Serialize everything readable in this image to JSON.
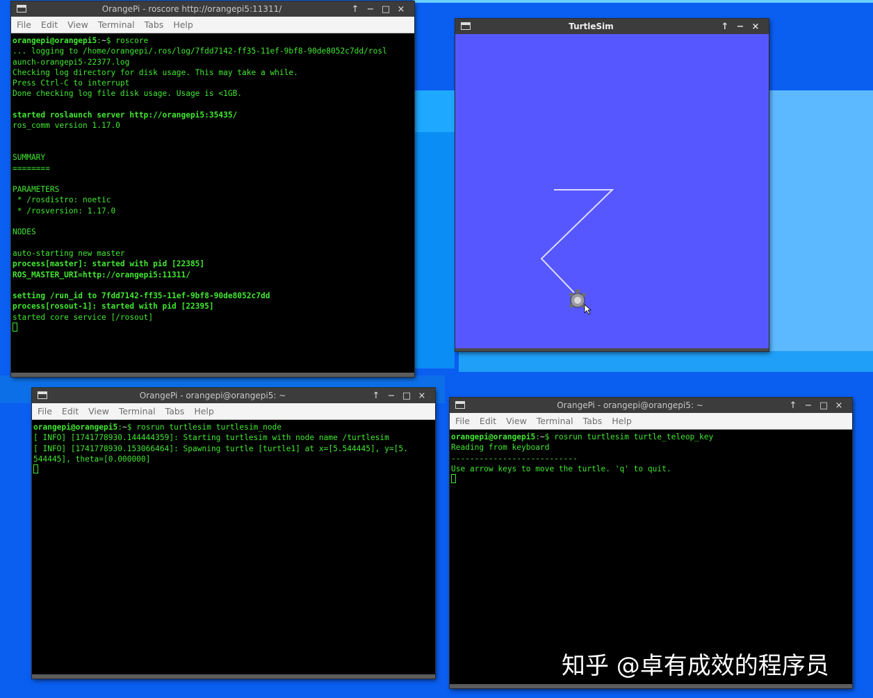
{
  "menu": [
    "File",
    "Edit",
    "View",
    "Terminal",
    "Tabs",
    "Help"
  ],
  "window_controls": [
    "↑",
    "−",
    "□",
    "×"
  ],
  "roscore_window": {
    "title": "OrangePi - roscore http://orangepi5:11311/",
    "lines": [
      [
        {
          "t": "orangepi@orangepi5",
          "c": "b"
        },
        {
          "t": ":",
          "c": ""
        },
        {
          "t": "~",
          "c": "w"
        },
        {
          "t": "$ roscore",
          "c": ""
        }
      ],
      [
        {
          "t": "... logging to /home/orangepi/.ros/log/7fdd7142-ff35-11ef-9bf8-90de8052c7dd/rosl",
          "c": ""
        }
      ],
      [
        {
          "t": "aunch-orangepi5-22377.log",
          "c": ""
        }
      ],
      [
        {
          "t": "Checking log directory for disk usage. This may take a while.",
          "c": ""
        }
      ],
      [
        {
          "t": "Press Ctrl-C to interrupt",
          "c": ""
        }
      ],
      [
        {
          "t": "Done checking log file disk usage. Usage is <1GB.",
          "c": ""
        }
      ],
      [],
      [
        {
          "t": "started roslaunch server http://orangepi5:35435/",
          "c": "b"
        }
      ],
      [
        {
          "t": "ros_comm version 1.17.0",
          "c": ""
        }
      ],
      [],
      [],
      [
        {
          "t": "SUMMARY",
          "c": ""
        }
      ],
      [
        {
          "t": "========",
          "c": ""
        }
      ],
      [],
      [
        {
          "t": "PARAMETERS",
          "c": ""
        }
      ],
      [
        {
          "t": " * /rosdistro: noetic",
          "c": ""
        }
      ],
      [
        {
          "t": " * /rosversion: 1.17.0",
          "c": ""
        }
      ],
      [],
      [
        {
          "t": "NODES",
          "c": ""
        }
      ],
      [],
      [
        {
          "t": "auto-starting new master",
          "c": ""
        }
      ],
      [
        {
          "t": "process[master]: started with pid [22385]",
          "c": "b"
        }
      ],
      [
        {
          "t": "ROS_MASTER_URI=http://orangepi5:11311/",
          "c": "b"
        }
      ],
      [],
      [
        {
          "t": "setting /run_id to 7fdd7142-ff35-11ef-9bf8-90de8052c7dd",
          "c": "b"
        }
      ],
      [
        {
          "t": "process[rosout-1]: started with pid [22395]",
          "c": "b"
        }
      ],
      [
        {
          "t": "started core service [/rosout]",
          "c": ""
        }
      ],
      [
        {
          "cursor": true
        }
      ]
    ]
  },
  "turtlesim_window": {
    "title": "TurtleSim",
    "background_color": "#5657ff",
    "path_color": "#dcdcff",
    "turtle_pose": {
      "x": 5.544445,
      "y": 5.544445,
      "theta": 0.0
    }
  },
  "node_window": {
    "title": "OrangePi - orangepi@orangepi5: ~",
    "lines": [
      [
        {
          "t": "orangepi@orangepi5",
          "c": "b"
        },
        {
          "t": ":",
          "c": ""
        },
        {
          "t": "~",
          "c": "w"
        },
        {
          "t": "$ rosrun turtlesim turtlesim_node",
          "c": ""
        }
      ],
      [
        {
          "t": "[ INFO] [1741778930.144444359]: Starting turtlesim with node name /turtlesim",
          "c": ""
        }
      ],
      [
        {
          "t": "[ INFO] [1741778930.153066464]: Spawning turtle [turtle1] at x=[5.544445], y=[5.",
          "c": ""
        }
      ],
      [
        {
          "t": "544445], theta=[0.000000]",
          "c": ""
        }
      ],
      [
        {
          "cursor": true
        }
      ]
    ]
  },
  "teleop_window": {
    "title": "OrangePi - orangepi@orangepi5: ~",
    "lines": [
      [
        {
          "t": "orangepi@orangepi5",
          "c": "b"
        },
        {
          "t": ":",
          "c": ""
        },
        {
          "t": "~",
          "c": "w"
        },
        {
          "t": "$ rosrun turtlesim turtle_teleop_key",
          "c": ""
        }
      ],
      [
        {
          "t": "Reading from keyboard",
          "c": ""
        }
      ],
      [
        {
          "t": "---------------------------",
          "c": ""
        }
      ],
      [
        {
          "t": "Use arrow keys to move the turtle. 'q' to quit.",
          "c": ""
        }
      ],
      [
        {
          "cursor": true
        }
      ]
    ]
  },
  "watermark": "知乎 @卓有成效的程序员"
}
